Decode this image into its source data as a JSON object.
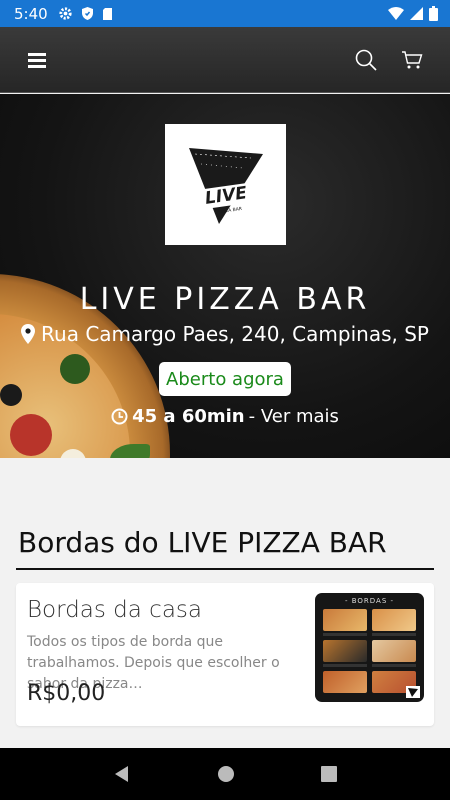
{
  "status_bar": {
    "time": "5:40"
  },
  "header": {
    "menu_icon": "hamburger-menu-icon",
    "search_icon": "search-icon",
    "cart_icon": "cart-icon"
  },
  "store": {
    "logo_text": "LIVE",
    "logo_subtext": "PIZZA BAR",
    "name": "LIVE PIZZA BAR",
    "address": "Rua Camargo Paes, 240, Campinas, SP",
    "status": "Aberto agora",
    "delivery_time": "45 a 60min",
    "more_link": " - Ver mais"
  },
  "section": {
    "title": "Bordas do LIVE PIZZA BAR",
    "items": [
      {
        "title": "Bordas da casa",
        "description": "Todos os tipos de borda que trabalhamos. Depois que escolher o sabor da pizza…",
        "price": "R$0,00",
        "thumbnail_header": "- BORDAS -"
      }
    ]
  },
  "colors": {
    "status_bar": "#1976d2",
    "open_green": "#1a8a1a"
  }
}
